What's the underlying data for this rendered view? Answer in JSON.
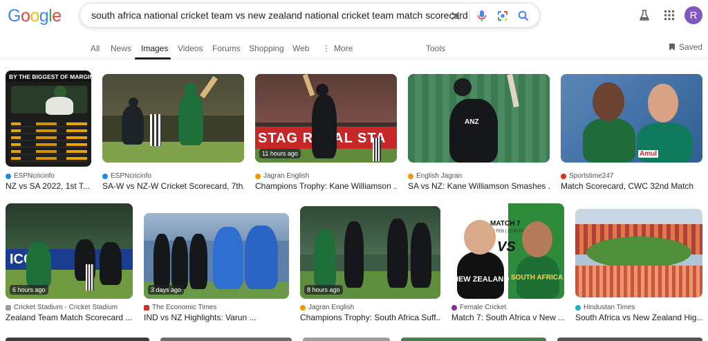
{
  "logo": "Google",
  "search": {
    "query": "south africa national cricket team vs new zealand national cricket team match scorecard"
  },
  "header": {
    "avatar_letter": "R"
  },
  "tabs": [
    "All",
    "News",
    "Images",
    "Videos",
    "Forums",
    "Shopping",
    "Web",
    "More",
    "Tools"
  ],
  "saved_label": "Saved",
  "colors": {
    "accent": "#1a73e8",
    "active_tab": "#202124",
    "avatar": "#7e57c2"
  },
  "results": [
    {
      "source": "ESPNcricinfo",
      "title": "NZ vs SA 2022, 1st T...",
      "overlay_title": "BY THE BIGGEST OF MARGINS",
      "favicon_color": "#1e88e5"
    },
    {
      "source": "ESPNcricinfo",
      "title": "SA-W vs NZ-W Cricket Scorecard, 7th...",
      "favicon_color": "#1e88e5"
    },
    {
      "source": "Jagran English",
      "title": "Champions Trophy: Kane Williamson ...",
      "badge": "11 hours ago",
      "banner": "STAG ROYAL STA",
      "favicon_color": "#f29900"
    },
    {
      "source": "English Jagran",
      "title": "SA vs NZ: Kane Williamson Smashes ...",
      "jersey": "ANZ",
      "favicon_color": "#f29900"
    },
    {
      "source": "Sportstime247",
      "title": "Match Scorecard, CWC 32nd Match",
      "jersey": "Amul",
      "favicon_color": "#d93025"
    },
    {
      "source": "Cricket Stadium - Cricket Stadium",
      "title": "Zealand Team Match Scorecard ...",
      "badge": "6 hours ago",
      "banner": "ICC",
      "favicon_color": "#9aa0a6"
    },
    {
      "source": "The Economic Times",
      "title": "IND vs NZ Highlights: Varun ...",
      "badge": "3 days ago",
      "favicon_color": "#d93025"
    },
    {
      "source": "Jagran English",
      "title": "Champions Trophy: South Africa Suff...",
      "badge": "8 hours ago",
      "favicon_color": "#f29900"
    },
    {
      "source": "Female Cricket",
      "title": "Match 7: South Africa v New ...",
      "match_label": "MATCH 7",
      "match_info": "13 FEB | 10:30 PM IST",
      "match_vs": "VS",
      "team1": "NEW ZEALAND",
      "team2": "SOUTH AFRICA",
      "favicon_color": "#8e24aa"
    },
    {
      "source": "Hindustan Times",
      "title": "South Africa vs New Zealand Hig...",
      "favicon_color": "#12b5cb"
    }
  ]
}
